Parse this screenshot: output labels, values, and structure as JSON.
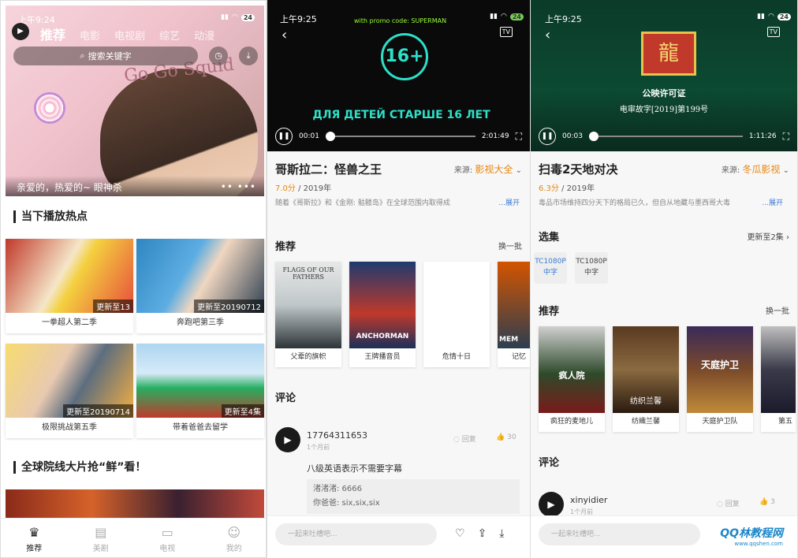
{
  "phone1": {
    "status_time": "上午9:24",
    "battery": "24",
    "nav": [
      {
        "label": "推荐",
        "active": true
      },
      {
        "label": "电影"
      },
      {
        "label": "电视剧"
      },
      {
        "label": "综艺"
      },
      {
        "label": "动漫"
      }
    ],
    "search_placeholder": "搜索关键字",
    "hero_caption": "亲爱的，热爱的~ 眼神杀",
    "hero_art_text": "Go Go Squid",
    "section1": "当下播放热点",
    "cards": [
      {
        "title": "一拳超人第二季",
        "badge": "更新至13"
      },
      {
        "title": "奔跑吧第三季",
        "badge": "更新至20190712"
      },
      {
        "title": "极限挑战第五季",
        "badge": "更新至20190714"
      },
      {
        "title": "带着爸爸去留学",
        "badge": "更新至4集"
      }
    ],
    "section2": "全球院线大片抢“鲜”看！",
    "tabs": [
      {
        "label": "推荐",
        "icon": "crown-icon",
        "active": true
      },
      {
        "label": "美剧",
        "icon": "film-icon"
      },
      {
        "label": "电视",
        "icon": "tv-icon"
      },
      {
        "label": "我的",
        "icon": "profile-icon"
      }
    ]
  },
  "phone2": {
    "status_time": "上午9:25",
    "battery": "24",
    "promo_text": "with promo code: SUPERMAN",
    "rating_badge": "16+",
    "rating_text": "ДЛЯ ДЕТЕЙ СТАРШЕ 16 ЛЕТ",
    "tv_label": "TV",
    "time_current": "00:01",
    "time_total": "2:01:49",
    "progress": 0.0,
    "title": "哥斯拉二：怪兽之王",
    "source_label": "来源:",
    "source_value": "影视大全",
    "score": "7.0分",
    "year": "/ 2019年",
    "desc": "随着《哥斯拉》和《金刚: 骷髅岛》在全球范围内取得成",
    "more": "...展开",
    "rec_title": "推荐",
    "refresh": "换一批",
    "posters": [
      {
        "title": "父辈的旗帜",
        "art": "FLAGS OF OUR FATHERS"
      },
      {
        "title": "王牌播音员",
        "art": "ANCHORMAN"
      },
      {
        "title": "危情十日",
        "art": ""
      },
      {
        "title": "记忆",
        "art": "MEM"
      }
    ],
    "comment_title": "评论",
    "comment": {
      "user": "17764311653",
      "time": "1个月前",
      "reply_label": "回复",
      "likes": "30",
      "text": "八级英语表示不需要字幕",
      "replies": [
        "渚渚渚: 6666",
        "你爸爸: six,six,six"
      ]
    },
    "input_placeholder": "一起来吐槽吧..."
  },
  "phone3": {
    "status_time": "上午9:25",
    "battery": "24",
    "license_text": "公映许可证",
    "license_no": "电审故字[2019]第199号",
    "tv_label": "TV",
    "time_current": "00:03",
    "time_total": "1:11:26",
    "progress": 0.0,
    "title": "扫毒2天地对决",
    "source_label": "来源:",
    "source_value": "冬瓜影视",
    "score": "6.3分",
    "year": "/ 2019年",
    "desc": "毒品市场维持四分天下的格局已久，但自从地藏与墨西哥大毒",
    "more": "...展开",
    "episodes_title": "选集",
    "episodes_link": "更新至2集",
    "episodes": [
      {
        "line1": "TC1080P",
        "line2": "中字",
        "selected": true
      },
      {
        "line1": "TC1080P",
        "line2": "中字"
      }
    ],
    "rec_title": "推荐",
    "refresh": "换一批",
    "posters": [
      {
        "title": "疯狂的麦地儿",
        "art": "疯人院"
      },
      {
        "title": "纺織兰馨",
        "art": "纺织兰馨"
      },
      {
        "title": "天庭护卫队",
        "art": "天庭护卫"
      },
      {
        "title": "第五",
        "art": ""
      }
    ],
    "comment_title": "评论",
    "comment": {
      "user": "xinyidier",
      "time": "1个月前",
      "reply_label": "回复",
      "likes": "3"
    },
    "input_placeholder": "一起来吐槽吧...",
    "watermark": "QQ林教程网",
    "watermark_url": "www.qqshen.com"
  }
}
